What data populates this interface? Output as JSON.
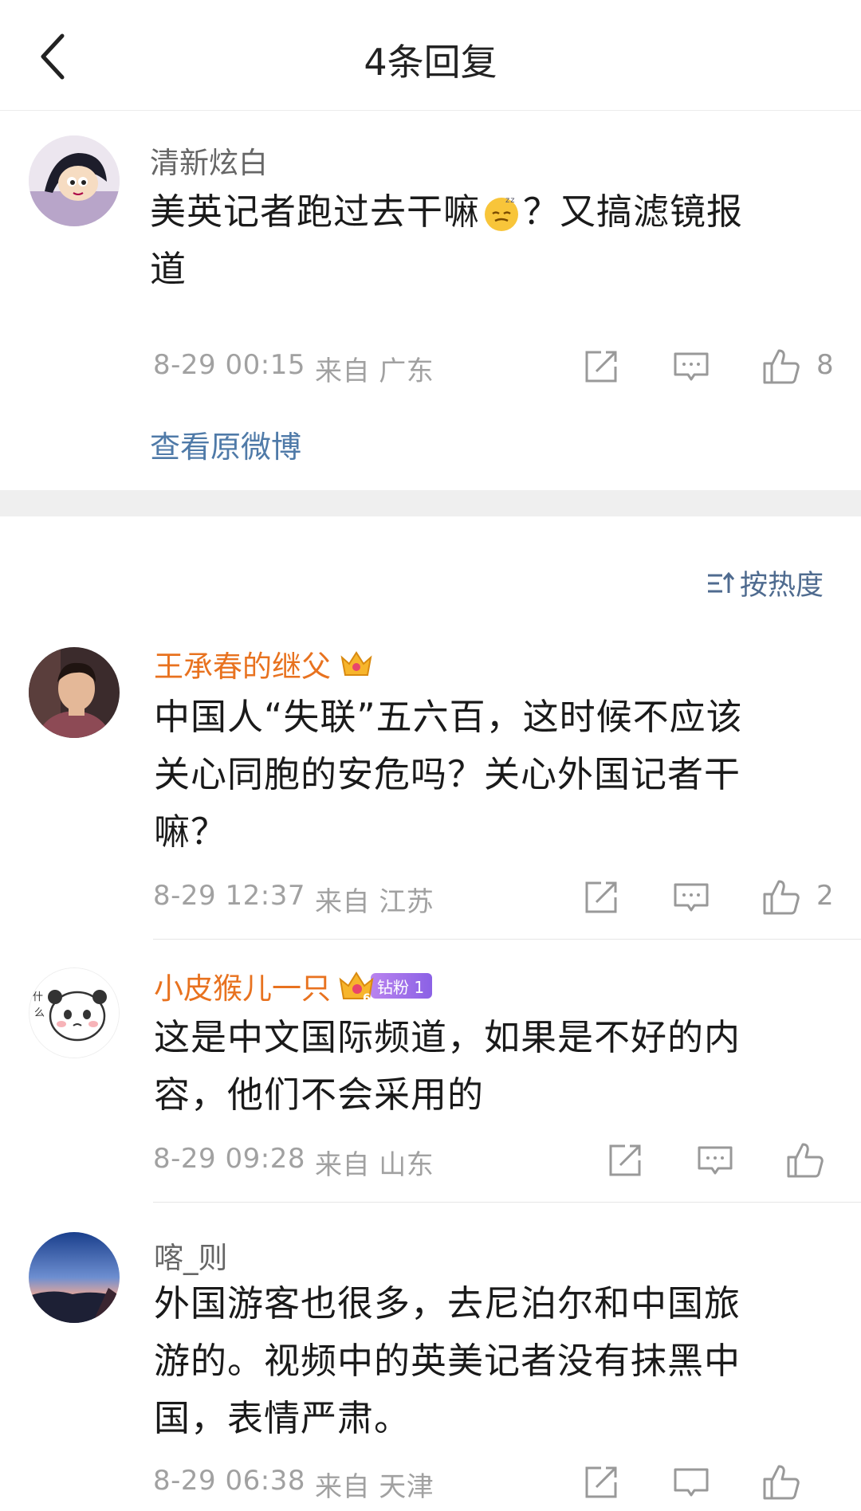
{
  "header": {
    "title": "4条回复"
  },
  "main_comment": {
    "username": "清新炫白",
    "text_line1": "美英记者跑过去干嘛",
    "text_line1_tail": "？又搞滤镜报",
    "text_line2": "道",
    "date": "8-29 00:15",
    "location": "来自 广东",
    "likes": "8",
    "view_original": "查看原微博"
  },
  "sort": {
    "label": "按热度"
  },
  "replies": [
    {
      "username": "王承春的继父",
      "lines": [
        "中国人“失联”五六百，这时候不应该",
        "关心同胞的安危吗？关心外国记者干",
        "嘛？"
      ],
      "date": "8-29 12:37",
      "location": "来自 江苏",
      "likes": "2"
    },
    {
      "username": "小皮猴儿一只",
      "badge": "钻粉 1",
      "lines": [
        "这是中文国际频道，如果是不好的内",
        "容，他们不会采用的"
      ],
      "date": "8-29 09:28",
      "location": "来自 山东",
      "likes": ""
    },
    {
      "username": "喀_则",
      "lines": [
        "外国游客也很多，去尼泊尔和中国旅",
        "游的。视频中的英美记者没有抹黑中",
        "国，表情严肃。"
      ],
      "date": "8-29 06:38",
      "location": "来自 天津",
      "likes": ""
    }
  ],
  "colors": {
    "username_highlight": "#e8721f",
    "link": "#4f7aa8",
    "meta": "#a1a1a1"
  }
}
